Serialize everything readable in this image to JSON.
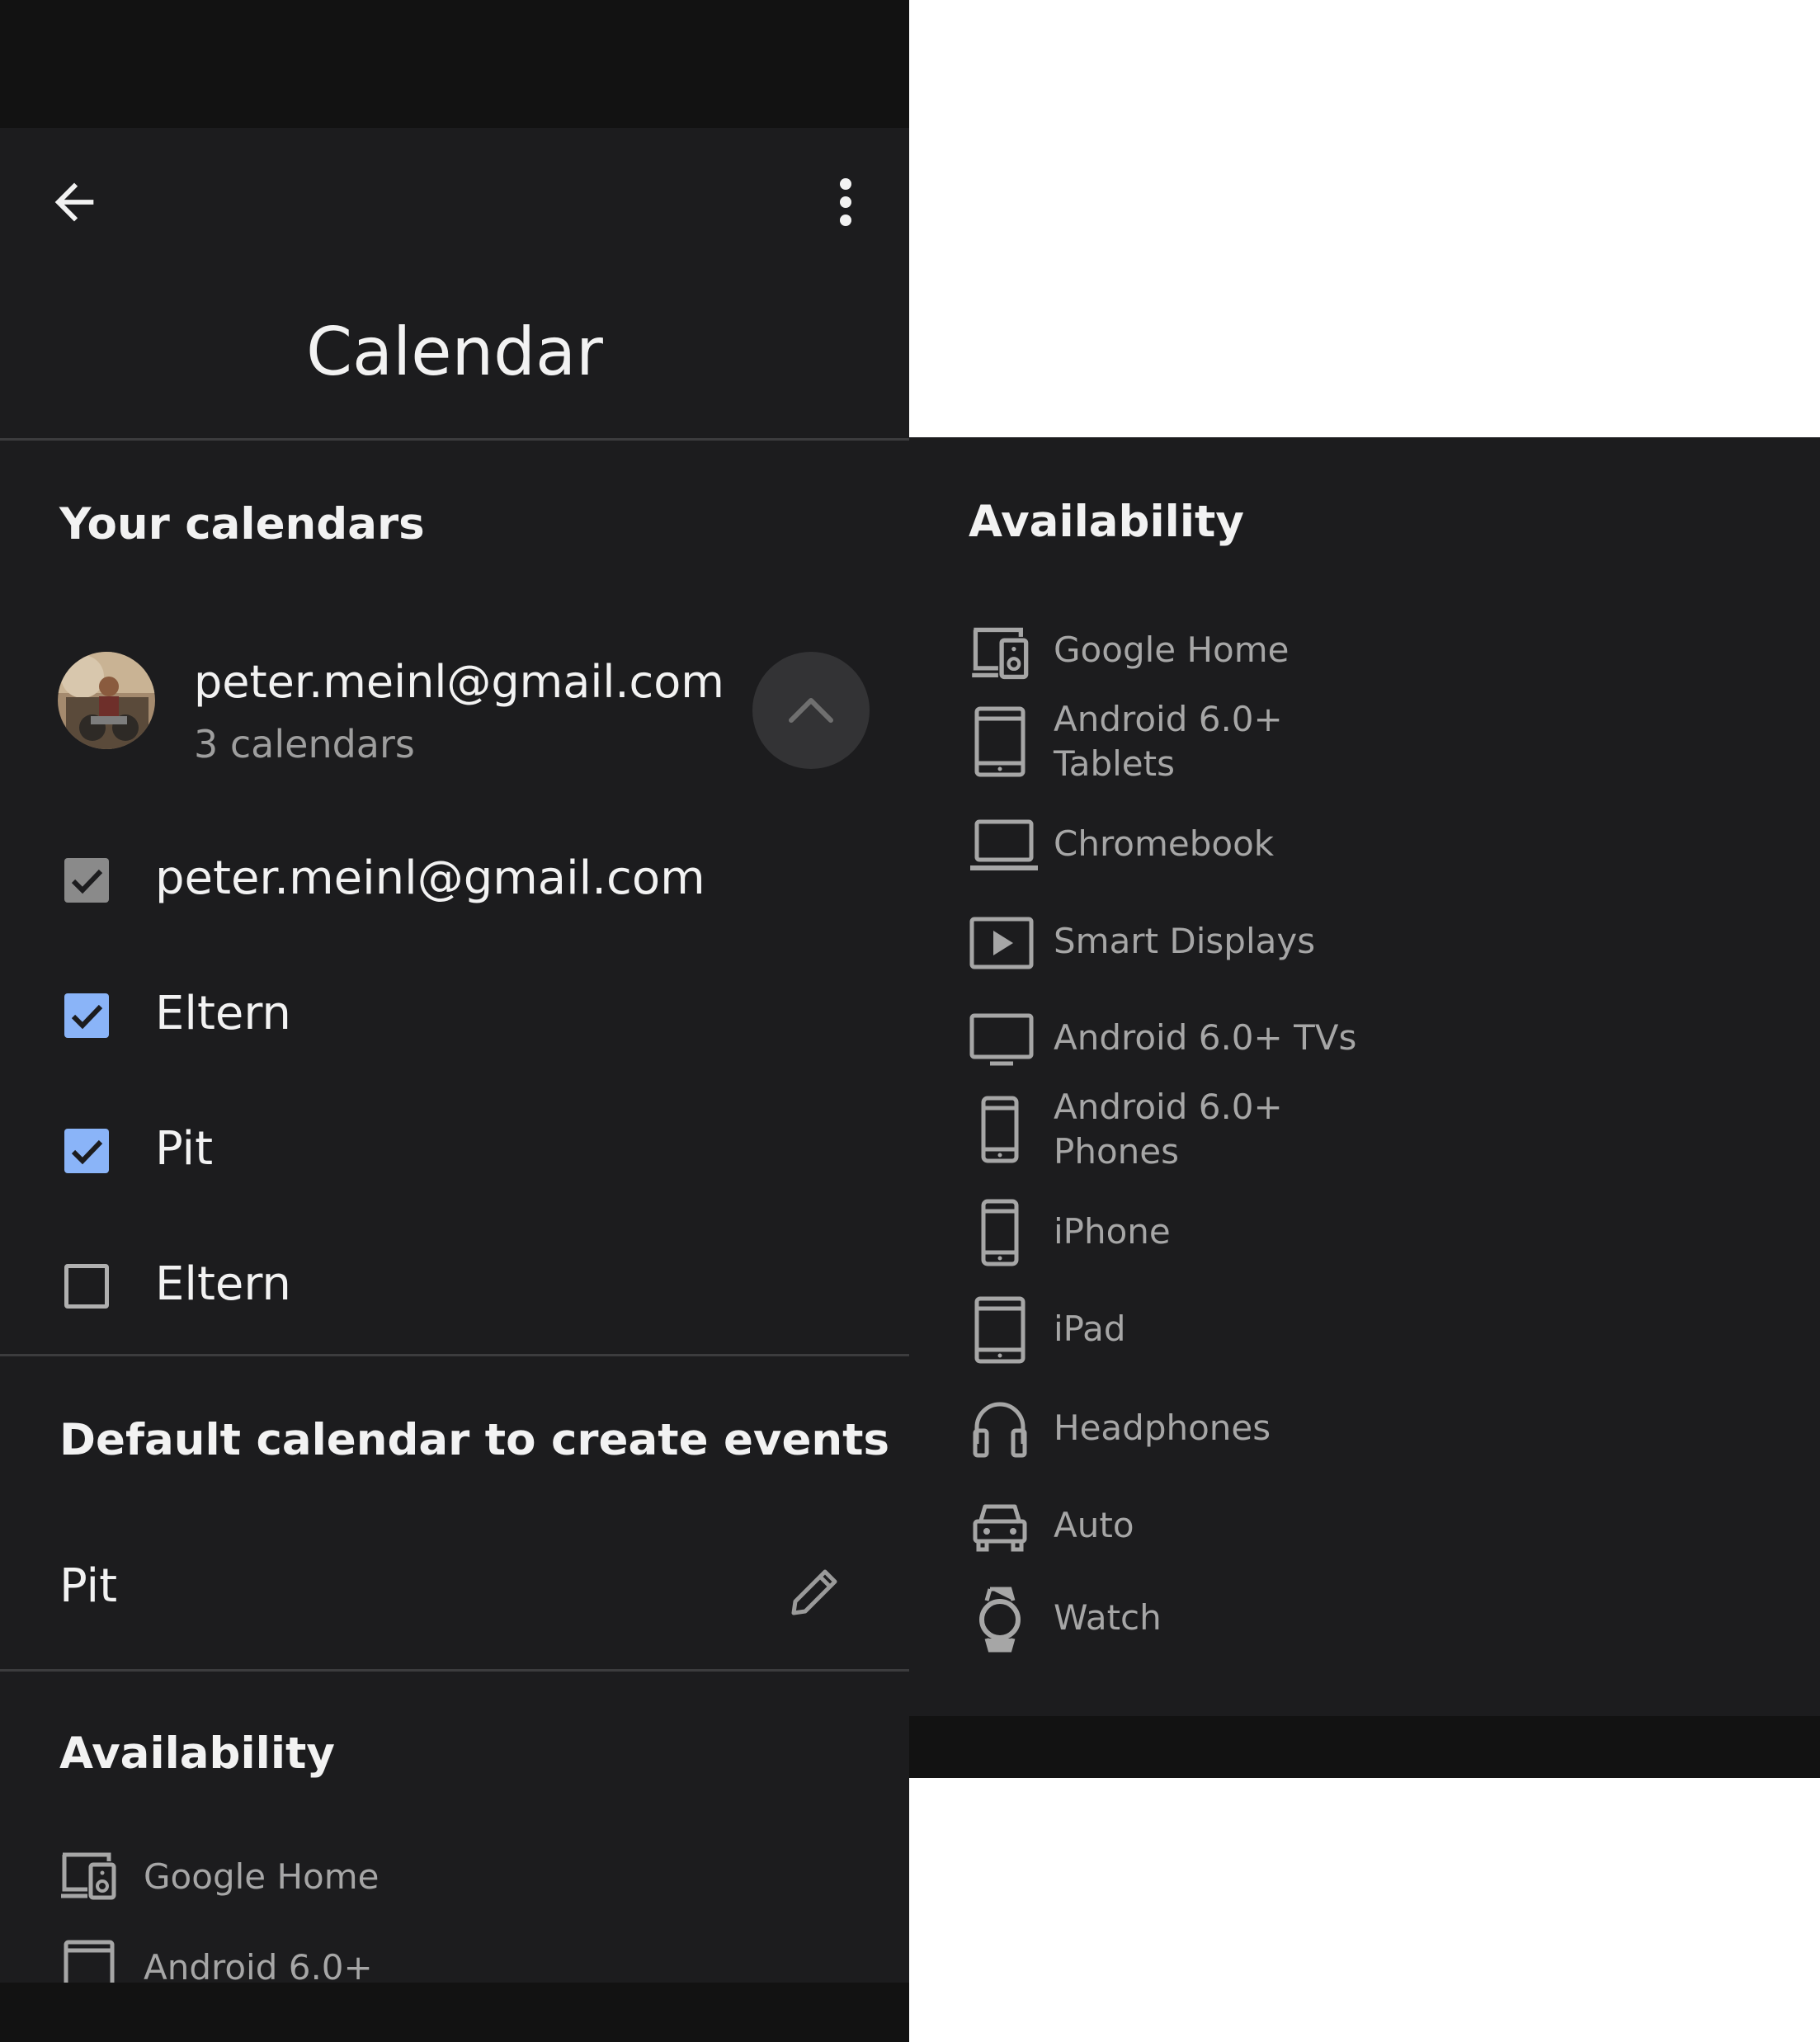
{
  "header": {
    "title": "Calendar"
  },
  "your_calendars": {
    "heading": "Your calendars",
    "account": {
      "email": "peter.meinl@gmail.com",
      "count": "3 calendars"
    },
    "items": [
      {
        "label": "peter.meinl@gmail.com",
        "checked": true,
        "state": "disabled"
      },
      {
        "label": "Eltern",
        "checked": true,
        "state": "enabled"
      },
      {
        "label": "Pit",
        "checked": true,
        "state": "enabled"
      },
      {
        "label": "Eltern",
        "checked": false,
        "state": "enabled"
      }
    ]
  },
  "default_calendar": {
    "heading": "Default calendar to create events",
    "value": "Pit"
  },
  "availability": {
    "heading": "Availability",
    "left_items": [
      "Google Home",
      "Android 6.0+"
    ],
    "devices": [
      {
        "icon": "google-home-icon",
        "label": "Google Home"
      },
      {
        "icon": "tablet-icon",
        "label": "Android 6.0+\nTablets"
      },
      {
        "icon": "laptop-icon",
        "label": "Chromebook"
      },
      {
        "icon": "smart-display-icon",
        "label": "Smart Displays"
      },
      {
        "icon": "tv-icon",
        "label": "Android 6.0+ TVs"
      },
      {
        "icon": "phone-icon",
        "label": "Android 6.0+\nPhones"
      },
      {
        "icon": "iphone-icon",
        "label": "iPhone"
      },
      {
        "icon": "ipad-icon",
        "label": "iPad"
      },
      {
        "icon": "headphones-icon",
        "label": "Headphones"
      },
      {
        "icon": "car-icon",
        "label": "Auto"
      },
      {
        "icon": "watch-icon",
        "label": "Watch"
      }
    ]
  },
  "colors": {
    "background": "#1c1c1e",
    "checkbox_checked": "#8ab4f8",
    "checkbox_disabled": "#8a8a8a",
    "text_primary": "#f2f2f2",
    "text_secondary": "#a6a6a6"
  }
}
